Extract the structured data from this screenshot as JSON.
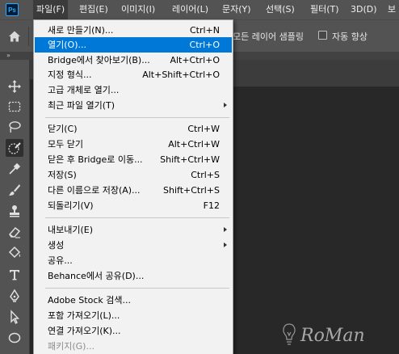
{
  "app": {
    "logo": "Ps"
  },
  "menubar": {
    "items": [
      {
        "label": "파일(F)"
      },
      {
        "label": "편집(E)"
      },
      {
        "label": "이미지(I)"
      },
      {
        "label": "레이어(L)"
      },
      {
        "label": "문자(Y)"
      },
      {
        "label": "선택(S)"
      },
      {
        "label": "필터(T)"
      },
      {
        "label": "3D(D)"
      },
      {
        "label": "보"
      }
    ]
  },
  "options_bar": {
    "sample_layers_label": "모든 레이어 샘플링",
    "auto_enhance_label": "자동 향상"
  },
  "tools": [
    {
      "name": "move-tool-icon"
    },
    {
      "name": "marquee-tool-icon"
    },
    {
      "name": "lasso-tool-icon"
    },
    {
      "name": "quick-selection-tool-icon"
    },
    {
      "name": "eyedropper-tool-icon"
    },
    {
      "name": "brush-tool-icon"
    },
    {
      "name": "clone-stamp-tool-icon"
    },
    {
      "name": "eraser-tool-icon"
    },
    {
      "name": "paint-bucket-tool-icon"
    },
    {
      "name": "type-tool-icon"
    },
    {
      "name": "pen-tool-icon"
    },
    {
      "name": "path-selection-tool-icon"
    },
    {
      "name": "ellipse-tool-icon"
    }
  ],
  "file_menu": {
    "items": [
      {
        "label": "새로 만들기(N)...",
        "shortcut": "Ctrl+N"
      },
      {
        "label": "열기(O)...",
        "shortcut": "Ctrl+O"
      },
      {
        "label": "Bridge에서 찾아보기(B)...",
        "shortcut": "Alt+Ctrl+O"
      },
      {
        "label": "지정 형식...",
        "shortcut": "Alt+Shift+Ctrl+O"
      },
      {
        "label": "고급 개체로 열기...",
        "shortcut": ""
      },
      {
        "label": "최근 파일 열기(T)",
        "shortcut": ""
      },
      {
        "label": "닫기(C)",
        "shortcut": "Ctrl+W"
      },
      {
        "label": "모두 닫기",
        "shortcut": "Alt+Ctrl+W"
      },
      {
        "label": "닫은 후 Bridge로 이동...",
        "shortcut": "Shift+Ctrl+W"
      },
      {
        "label": "저장(S)",
        "shortcut": "Ctrl+S"
      },
      {
        "label": "다른 이름으로 저장(A)...",
        "shortcut": "Shift+Ctrl+S"
      },
      {
        "label": "되돌리기(V)",
        "shortcut": "F12"
      },
      {
        "label": "내보내기(E)",
        "shortcut": ""
      },
      {
        "label": "생성",
        "shortcut": ""
      },
      {
        "label": "공유...",
        "shortcut": ""
      },
      {
        "label": "Behance에서 공유(D)...",
        "shortcut": ""
      },
      {
        "label": "Adobe Stock 검색...",
        "shortcut": ""
      },
      {
        "label": "포함 가져오기(L)...",
        "shortcut": ""
      },
      {
        "label": "연결 가져오기(K)...",
        "shortcut": ""
      },
      {
        "label": "패키지(G)...",
        "shortcut": ""
      }
    ]
  },
  "watermark": {
    "text": "RoMan"
  },
  "colors": {
    "highlight": "#0078d7",
    "menubar_bg": "#535353",
    "canvas_bg": "#282828"
  }
}
